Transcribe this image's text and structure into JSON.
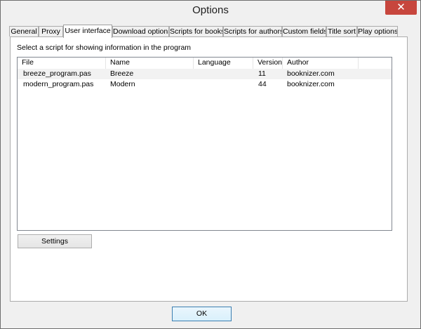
{
  "window": {
    "title": "Options",
    "close_glyph": "✕"
  },
  "tabs": [
    {
      "label": "General",
      "active": false
    },
    {
      "label": "Proxy",
      "active": false
    },
    {
      "label": "User interface",
      "active": true
    },
    {
      "label": "Download options",
      "active": false
    },
    {
      "label": "Scripts for books",
      "active": false
    },
    {
      "label": "Scripts for authors",
      "active": false
    },
    {
      "label": "Custom fields",
      "active": false
    },
    {
      "label": "Title sort",
      "active": false
    },
    {
      "label": "Play options",
      "active": false
    }
  ],
  "page": {
    "instruction": "Select a script for showing information in the program",
    "columns": [
      "File",
      "Name",
      "Language",
      "Version",
      "Author"
    ],
    "rows": [
      {
        "file": "breeze_program.pas",
        "name": "Breeze",
        "language": "",
        "version": "11",
        "author": "booknizer.com",
        "selected": true
      },
      {
        "file": "modern_program.pas",
        "name": "Modern",
        "language": "",
        "version": "44",
        "author": "booknizer.com",
        "selected": false
      }
    ],
    "settings_label": "Settings"
  },
  "footer": {
    "ok_label": "OK"
  }
}
